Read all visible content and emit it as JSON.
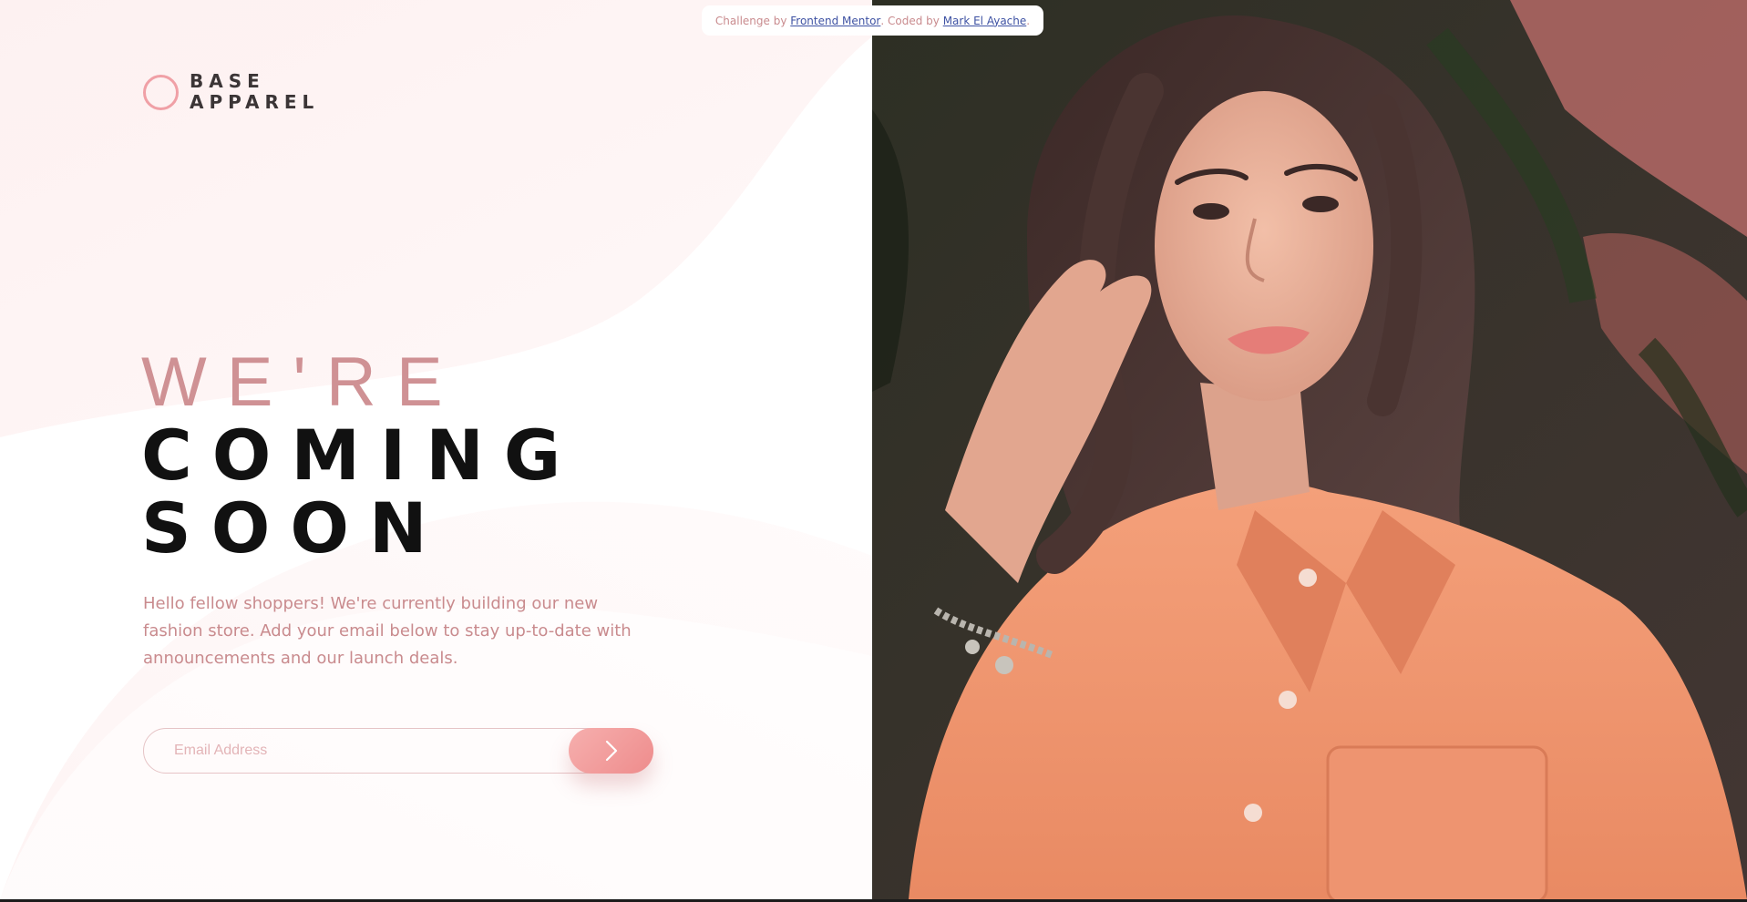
{
  "attribution": {
    "prefix": "Challenge by ",
    "challenge_link": "Frontend Mentor",
    "middle": ". Coded by ",
    "author_link": "Mark El Ayache",
    "suffix": "."
  },
  "logo": {
    "line1": "BASE",
    "line2": "APPAREL"
  },
  "headline": {
    "line1": "WE'RE",
    "line2": "COMING",
    "line3": "SOON"
  },
  "description": "Hello fellow shoppers! We're currently building our new fashion store. Add your email below to stay up-to-date with announcements and our launch deals.",
  "form": {
    "email_placeholder": "Email Address",
    "email_value": "",
    "submit_icon": "chevron-right-icon"
  },
  "hero_image": {
    "subject": "woman in orange shirt"
  },
  "colors": {
    "accent": "#ce9797",
    "dark_text": "#111111",
    "button_start": "#f6afae",
    "button_end": "#ee8c8c",
    "link": "#3e52a3"
  }
}
